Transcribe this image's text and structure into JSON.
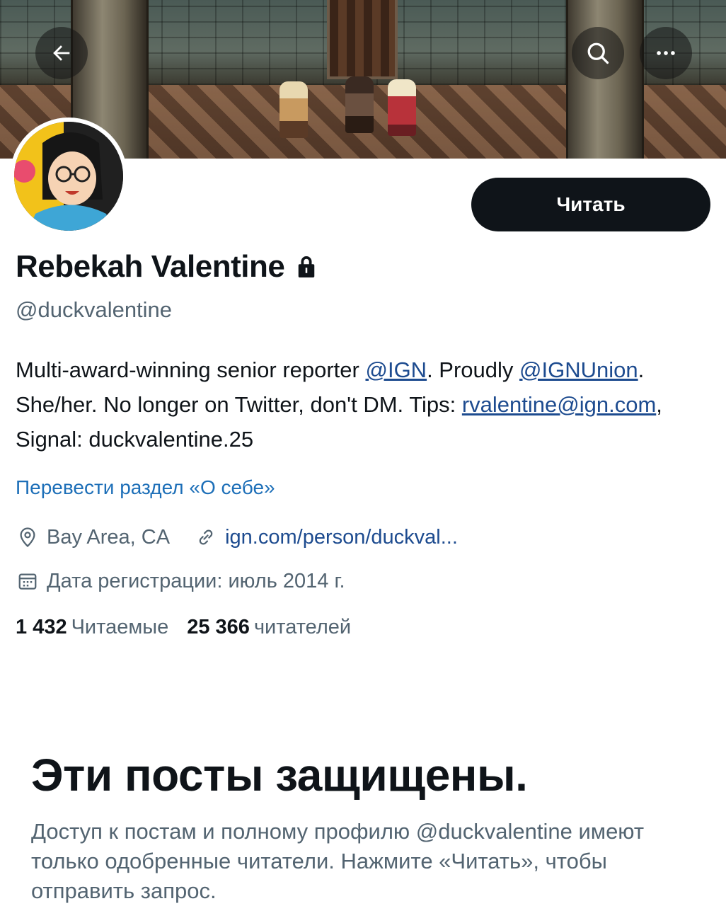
{
  "header": {
    "back_icon": "arrow-left-icon",
    "search_icon": "search-icon",
    "more_icon": "more-horizontal-icon"
  },
  "profile": {
    "display_name": "Rebekah Valentine",
    "lock_icon": "lock-icon",
    "handle": "@duckvalentine",
    "follow_label": "Читать",
    "bio": {
      "part1": "Multi-award-winning senior reporter ",
      "mention_ign": "@IGN",
      "part2": ". Proudly ",
      "mention_union": "@IGNUnion",
      "part3": ". She/her. No longer on Twitter, don't DM. Tips: ",
      "email": "rvalentine@ign.com",
      "part4": ", Signal: duckvalentine.25"
    },
    "translate_label": "Перевести раздел «О себе»",
    "location": "Bay Area, CA",
    "website": "ign.com/person/duckval...",
    "joined": "Дата регистрации: июль 2014 г.",
    "following_count": "1 432",
    "following_label": "Читаемые",
    "followers_count": "25 366",
    "followers_label": "читателей"
  },
  "protected": {
    "title": "Эти посты защищены.",
    "text": "Доступ к постам и полному профилю @duckvalentine имеют только одобренные читатели. Нажмите «Читать», чтобы отправить запрос."
  },
  "colors": {
    "text_primary": "#0f1419",
    "text_secondary": "#536471",
    "link": "#1d4b8f",
    "button_bg": "#0f1419"
  }
}
